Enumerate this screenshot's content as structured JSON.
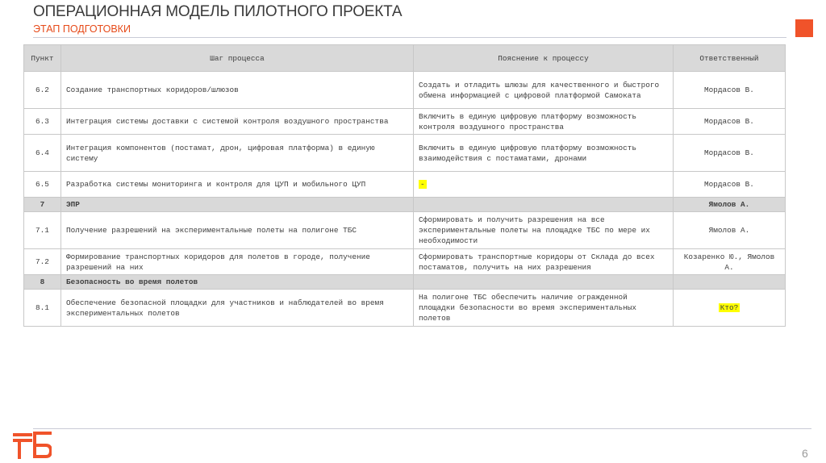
{
  "header": {
    "title": "ОПЕРАЦИОННАЯ МОДЕЛЬ ПИЛОТНОГО ПРОЕКТА",
    "subtitle": "ЭТАП ПОДГОТОВКИ"
  },
  "colors": {
    "accent": "#e64a19",
    "square": "#f0532a",
    "header_fill": "#d9d9d9",
    "highlight": "#ffff00"
  },
  "table": {
    "columns": [
      "Пункт",
      "Шаг процесса",
      "Пояснение к процессу",
      "Ответственный"
    ],
    "rows": [
      {
        "num": "6.2",
        "step": "Создание транспортных коридоров/шлюзов",
        "note": "Создать и отладить шлюзы для качественного и быстрого обмена информацией с цифровой платформой Самоката",
        "resp": "Мордасов В."
      },
      {
        "num": "6.3",
        "step": "Интеграция системы доставки с системой контроля воздушного пространства",
        "note": "Включить в единую цифровую платформу возможность контроля воздушного пространства",
        "resp": "Мордасов В."
      },
      {
        "num": "6.4",
        "step": "Интеграция компонентов (постамат, дрон, цифровая платформа) в единую систему",
        "note": "Включить в единую цифровую платформу возможность взаимодействия с постаматами, дронами",
        "resp": "Мордасов В."
      },
      {
        "num": "6.5",
        "step": "Разработка системы мониторинга и контроля для ЦУП и мобильного ЦУП",
        "note": "-",
        "resp": "Мордасов В."
      },
      {
        "num": "7",
        "step": "ЭПР",
        "note": "",
        "resp": "Ямолов А."
      },
      {
        "num": "7.1",
        "step": "Получение разрешений на экспериментальные полеты на полигоне ТБС",
        "note": "Сформировать и получить разрешения на все экспериментальные полеты на площадке ТБС по мере их необходимости",
        "resp": "Ямолов А."
      },
      {
        "num": "7.2",
        "step": "Формирование транспортных коридоров для полетов в городе, получение разрешений на них",
        "note": "Сформировать транспортные коридоры от Склада до всех постаматов, получить на них разрешения",
        "resp": "Козаренко Ю., Ямолов А."
      },
      {
        "num": "8",
        "step": "Безопасность во время полетов",
        "note": "",
        "resp": ""
      },
      {
        "num": "8.1",
        "step": "Обеспечение безопасной площадки для участников и наблюдателей во время экспериментальных полетов",
        "note": "На полигоне ТБС обеспечить наличие огражденной площадки безопасности во время экспериментальных полетов",
        "resp": "Кто?"
      }
    ]
  },
  "footer": {
    "page_number": "6"
  }
}
